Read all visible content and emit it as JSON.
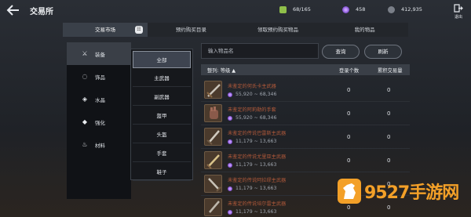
{
  "header": {
    "back_icon": "back-arrow-icon",
    "title": "交易所",
    "resources": [
      {
        "icon": "stamina-icon",
        "value": "68/165"
      },
      {
        "icon": "purple-gem-icon",
        "value": "458"
      },
      {
        "icon": "silver-coin-icon",
        "value": "412,935"
      }
    ],
    "exit_label": "退出"
  },
  "tabs": [
    {
      "label": "交易市场",
      "active": true
    },
    {
      "label": "预约购买目录",
      "active": false
    },
    {
      "label": "领取预约购买物品",
      "active": false
    },
    {
      "label": "我的物品",
      "active": false
    }
  ],
  "categories": [
    {
      "label": "装备",
      "icon": "crossed-swords-icon",
      "active": true
    },
    {
      "label": "饰品",
      "icon": "ring-icon",
      "active": false
    },
    {
      "label": "水晶",
      "icon": "crystal-icon",
      "active": false
    },
    {
      "label": "强化",
      "icon": "enhance-icon",
      "active": false
    },
    {
      "label": "材料",
      "icon": "flask-icon",
      "active": false
    }
  ],
  "subcategories": [
    {
      "label": "全部",
      "active": true
    },
    {
      "label": "主武器",
      "active": false
    },
    {
      "label": "副武器",
      "active": false
    },
    {
      "label": "盔甲",
      "active": false
    },
    {
      "label": "头盔",
      "active": false
    },
    {
      "label": "手套",
      "active": false
    },
    {
      "label": "鞋子",
      "active": false
    }
  ],
  "search": {
    "placeholder": "输入物品名",
    "query_label": "查询",
    "refresh_label": "刷新"
  },
  "table": {
    "sort_label": "整列: 等级 ▲",
    "col_registered": "登录个数",
    "col_total": "累积交易量",
    "rows": [
      {
        "name": "未鉴定的何氏卡主武器",
        "price": "55,920 ~ 68,346",
        "registered": "0",
        "total": "0"
      },
      {
        "name": "未鉴定的阿莉勒的手套",
        "price": "55,920 ~ 68,346",
        "registered": "0",
        "total": "0"
      },
      {
        "name": "未鉴定的传说巴雷斯主武器",
        "price": "11,179 ~ 13,663",
        "registered": "0",
        "total": "0"
      },
      {
        "name": "未鉴定的传说尤里亚主武器",
        "price": "11,179 ~ 13,663",
        "registered": "0",
        "total": "0"
      },
      {
        "name": "未鉴定的传说阿拉缪主武器",
        "price": "11,179 ~ 13,663",
        "registered": "0",
        "total": "0"
      },
      {
        "name": "未鉴定的传说培尔雷主武器",
        "price": "11,179 ~ 13,663",
        "registered": "0",
        "total": "0"
      }
    ]
  },
  "watermark": {
    "text": "9527手游网"
  }
}
